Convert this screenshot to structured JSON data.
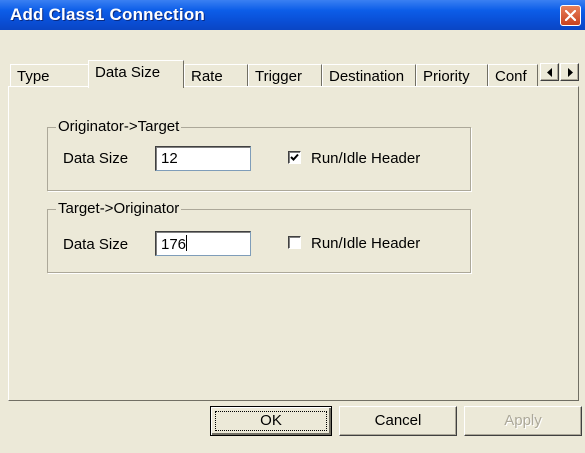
{
  "window": {
    "title": "Add Class1 Connection"
  },
  "tabs": [
    {
      "label": "Type"
    },
    {
      "label": "Data Size",
      "active": true
    },
    {
      "label": "Rate"
    },
    {
      "label": "Trigger"
    },
    {
      "label": "Destination"
    },
    {
      "label": "Priority"
    },
    {
      "label": "Conf"
    }
  ],
  "groups": {
    "originator_target": {
      "label": "Originator->Target",
      "data_size_label": "Data Size",
      "data_size_value": "12",
      "run_idle_label": "Run/Idle Header",
      "run_idle_checked": true
    },
    "target_originator": {
      "label": "Target->Originator",
      "data_size_label": "Data Size",
      "data_size_value": "176",
      "run_idle_label": "Run/Idle Header",
      "run_idle_checked": false
    }
  },
  "buttons": {
    "ok": "OK",
    "cancel": "Cancel",
    "apply": "Apply"
  },
  "icons": {
    "close": "close-icon",
    "tab_scroll_left": "arrow-left-icon",
    "tab_scroll_right": "arrow-right-icon",
    "checkmark": "checkmark-icon"
  },
  "colors": {
    "title_bar": "#0a4fd6",
    "dialog_face": "#ece9d8",
    "close_button": "#d5562f",
    "disabled_text": "#aca899"
  }
}
